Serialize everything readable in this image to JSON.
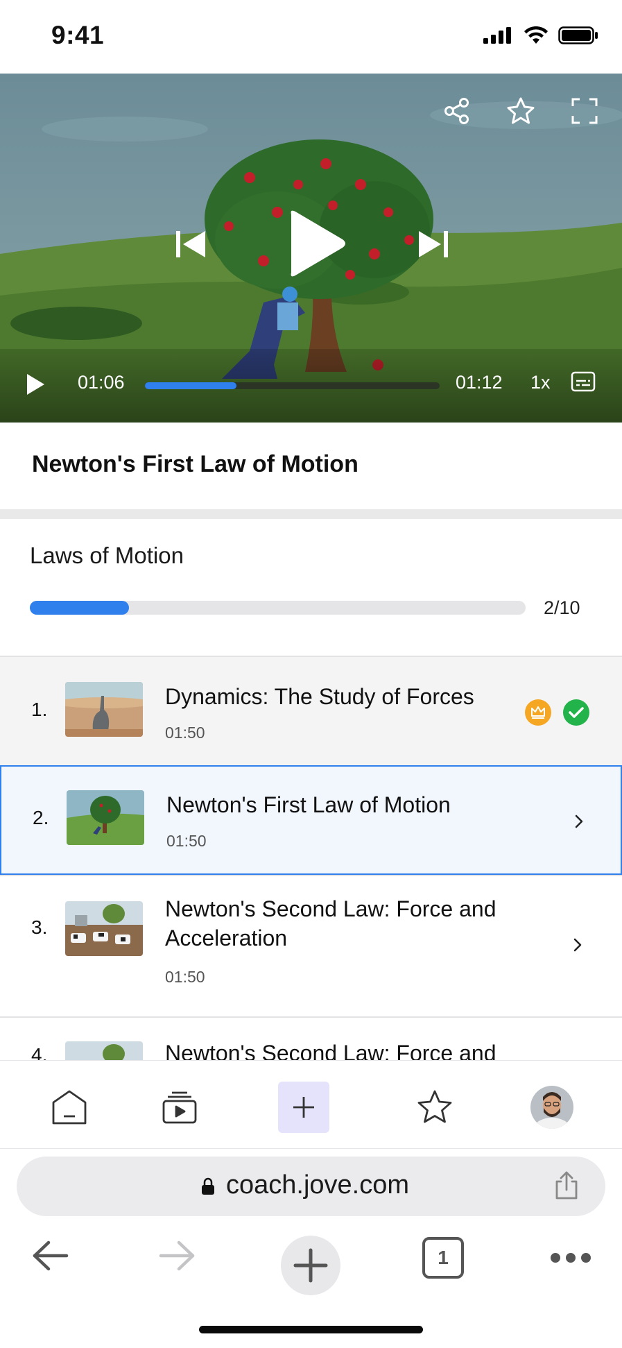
{
  "status_bar": {
    "time": "9:41"
  },
  "player": {
    "current_time": "01:06",
    "total_time": "01:12",
    "speed": "1x",
    "progress": 0.31,
    "top_icons": [
      "share-icon",
      "star-icon",
      "fullscreen-icon"
    ],
    "center_icons": [
      "skip-previous-icon",
      "play-icon",
      "skip-next-icon"
    ]
  },
  "lesson_title": "Newton's First Law of Motion",
  "course": {
    "title": "Laws of Motion",
    "progress_label": "2/10",
    "progress": 0.2
  },
  "lessons": [
    {
      "number": "1.",
      "title": "Dynamics: The Study of Forces",
      "duration": "01:50",
      "state": "completed",
      "badges": [
        "crown-icon",
        "check-icon"
      ]
    },
    {
      "number": "2.",
      "title": "Newton's First Law of Motion",
      "duration": "01:50",
      "state": "active"
    },
    {
      "number": "3.",
      "title": "Newton's Second Law: Force and Acceleration",
      "duration": "01:50",
      "state": "default"
    },
    {
      "number": "4.",
      "title": "Newton's Second Law: Force and",
      "duration": "",
      "state": "default"
    }
  ],
  "tab_bar": {
    "items": [
      "home-icon",
      "videos-icon",
      "add-icon",
      "favorites-icon",
      "profile-avatar"
    ]
  },
  "browser": {
    "url": "coach.jove.com",
    "tab_count": "1"
  },
  "colors": {
    "accent": "#2f80ed",
    "crown": "#f5a623",
    "check": "#22b34a",
    "add_tab_bg": "#e4e3fb"
  }
}
